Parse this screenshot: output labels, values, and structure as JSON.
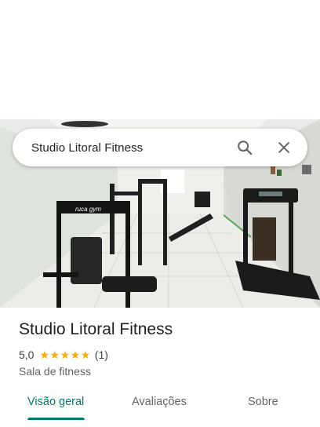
{
  "search": {
    "query": "Studio Litoral Fitness",
    "search_icon": "search-icon",
    "close_icon": "close-icon"
  },
  "photo": {
    "machine_brand": "ruca gym"
  },
  "place": {
    "name": "Studio Litoral Fitness",
    "rating": "5,0",
    "stars": 5,
    "review_count": "(1)",
    "category": "Sala de fitness"
  },
  "tabs": [
    {
      "label": "Visão geral",
      "active": true
    },
    {
      "label": "Avaliações",
      "active": false
    },
    {
      "label": "Sobre",
      "active": false
    }
  ],
  "colors": {
    "accent": "#00796b",
    "star": "#f9ab00",
    "text_primary": "#202124",
    "text_secondary": "#5f6368"
  }
}
